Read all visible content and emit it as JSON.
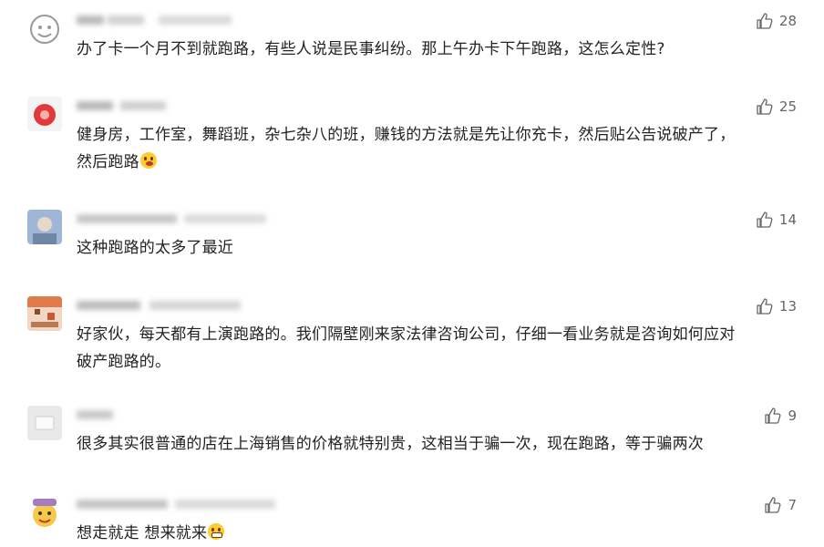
{
  "comments": [
    {
      "text": "办了卡一个月不到就跑路，有些人说是民事纠纷。那上午办卡下午跑路，这怎么定性?",
      "likes": "28",
      "avatar": "cartoon-face-icon"
    },
    {
      "text": "健身房，工作室，舞蹈班，杂七杂八的班，赚钱的方法就是先让你充卡，然后贴公告说破产了，\n然后跑路",
      "emoji": "wink-emoji",
      "likes": "25",
      "avatar": "red-badge-icon"
    },
    {
      "text": "这种跑路的太多了最近",
      "likes": "14",
      "avatar": "photo-avatar"
    },
    {
      "text": "好家伙，每天都有上演跑路的。我们隔壁刚来家法律咨询公司，仔细一看业务就是咨询如何应对\n破产跑路的。",
      "likes": "13",
      "avatar": "pixel-avatar"
    },
    {
      "text": "很多其实很普通的店在上海销售的价格就特别贵，这相当于骗一次，现在跑路，等于骗两次",
      "likes": "9",
      "avatar": "default-avatar"
    },
    {
      "text": "想走就走 想来就来",
      "emoji": "grin-emoji",
      "likes": "7",
      "avatar": "emoji-avatar"
    }
  ]
}
